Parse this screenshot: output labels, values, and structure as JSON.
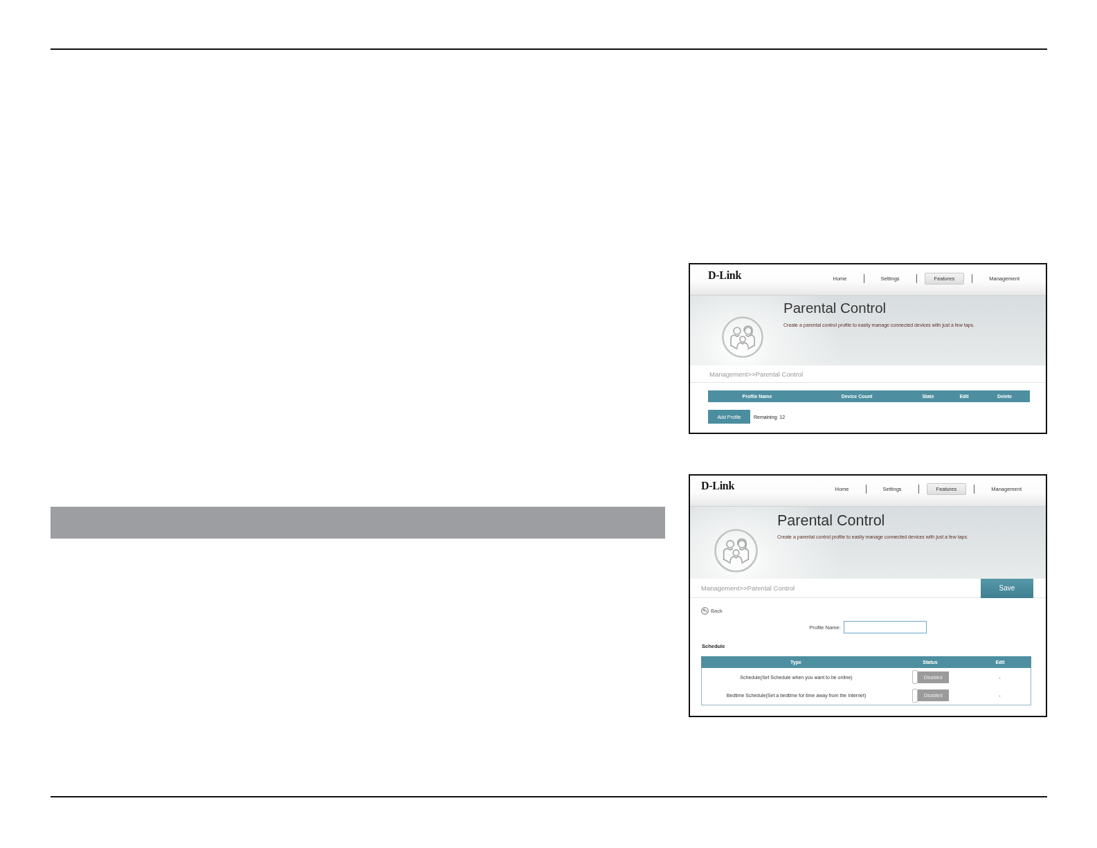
{
  "screenshots": [
    {
      "kind": "profile_list",
      "logo": "D-Link",
      "nav": [
        {
          "label": "Home",
          "selected": false
        },
        {
          "label": "Settings",
          "selected": false
        },
        {
          "label": "Features",
          "selected": true
        },
        {
          "label": "Management",
          "selected": false
        }
      ],
      "title": "Parental Control",
      "subtitle": "Create a parental control profile to easily manage connected devices with just a few taps.",
      "breadcrumb": "Management>>Parental Control",
      "table": {
        "columns": [
          "Profile Name",
          "Device Count",
          "State",
          "Edit",
          "Delete"
        ]
      },
      "add_button": "Add Profile",
      "remaining": "Remaining: 12"
    },
    {
      "kind": "profile_edit",
      "logo": "D-Link",
      "nav": [
        {
          "label": "Home",
          "selected": false
        },
        {
          "label": "Settings",
          "selected": false
        },
        {
          "label": "Features",
          "selected": true
        },
        {
          "label": "Management",
          "selected": false
        }
      ],
      "title": "Parental Control",
      "subtitle": "Create a parental control profile to easily manage connected devices with just a few taps.",
      "breadcrumb": "Management>>Parental Control",
      "save_button": "Save",
      "back_link": "Back",
      "profile_name_label": "Profile Name:",
      "section_heading": "Schedule",
      "schedule_table": {
        "columns": [
          "Type",
          "Status",
          "Edit"
        ],
        "rows": [
          {
            "type": "Schedule(Set Schedule when you want to be online)",
            "status": "Disabled",
            "on": false,
            "edit": "-"
          },
          {
            "type": "Bedtime Schedule(Set a bedtime for time away from the Internet)",
            "status": "Disabled",
            "on": false,
            "edit": "-"
          }
        ]
      }
    }
  ]
}
